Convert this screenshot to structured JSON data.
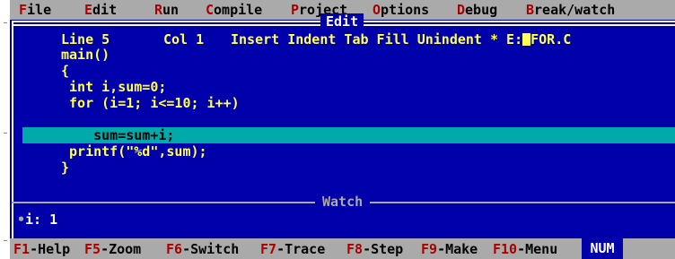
{
  "colors": {
    "background": "#0000aa",
    "menu_bar": "#aaaaaa",
    "hotkey": "#aa0000",
    "code_text": "#ffff55",
    "current_line": "#00aaaa",
    "frame": "#ffffff"
  },
  "menu": {
    "items": [
      {
        "hot": "F",
        "rest": "ile"
      },
      {
        "hot": "E",
        "rest": "dit"
      },
      {
        "hot": "R",
        "rest": "un"
      },
      {
        "hot": "C",
        "rest": "ompile"
      },
      {
        "hot": "P",
        "rest": "roject"
      },
      {
        "hot": "O",
        "rest": "ptions"
      },
      {
        "hot": "D",
        "rest": "ebug"
      },
      {
        "hot": "B",
        "rest": "reak/watch"
      }
    ]
  },
  "editor": {
    "title": "Edit",
    "status": {
      "line": "Line 5",
      "col": "Col 1",
      "modes": "Insert Indent Tab Fill Unindent * E:",
      "filename": "FOR.C"
    },
    "code_lines": [
      "main()",
      "{",
      " int i,sum=0;",
      " for (i=1; i<=10; i++)",
      "    sum=sum+i;",
      " printf(\"%d\",sum);",
      "}"
    ]
  },
  "watch": {
    "title": "Watch",
    "expression": "i: 1"
  },
  "function_keys": [
    {
      "key": "F1",
      "action": "-Help"
    },
    {
      "key": "F5",
      "action": "-Zoom"
    },
    {
      "key": "F6",
      "action": "-Switch"
    },
    {
      "key": "F7",
      "action": "-Trace"
    },
    {
      "key": "F8",
      "action": "-Step"
    },
    {
      "key": "F9",
      "action": "-Make"
    },
    {
      "key": "F10",
      "action": "-Menu"
    }
  ],
  "indicator": "NUM"
}
